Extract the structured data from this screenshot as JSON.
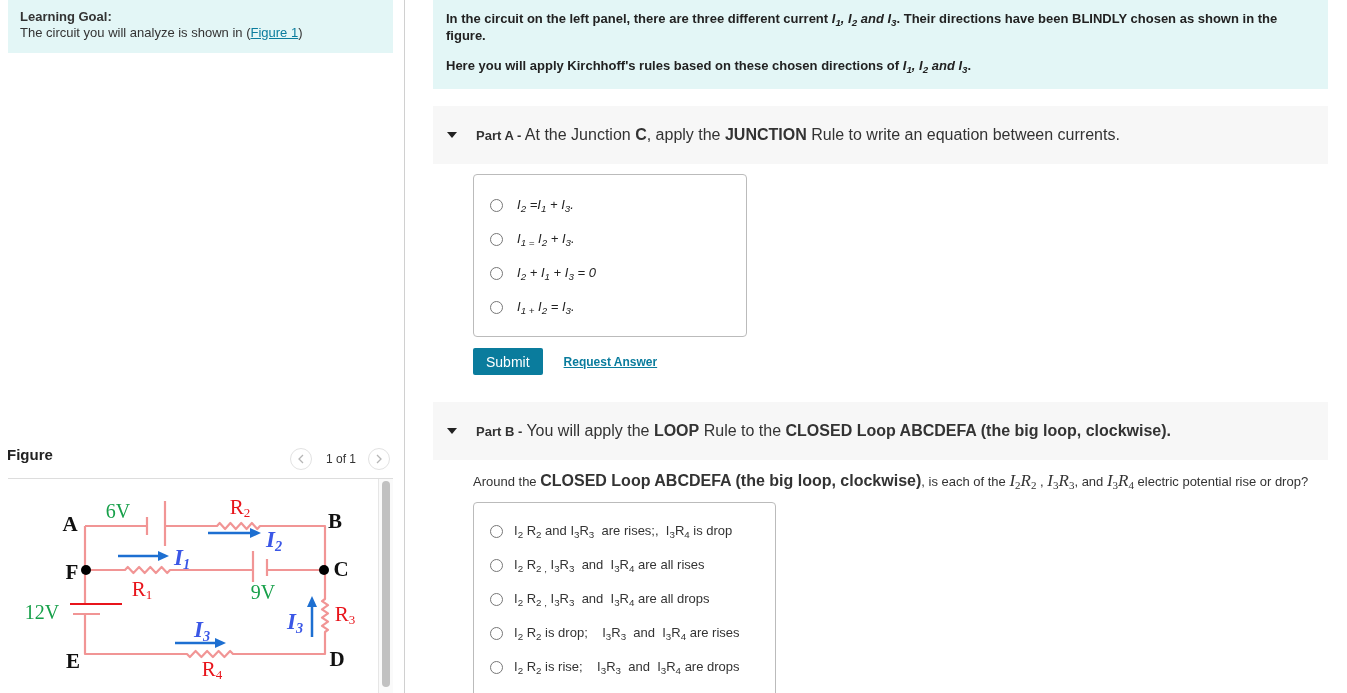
{
  "learning_goal": {
    "heading": "Learning Goal:",
    "text_before": "The circuit you will analyze is shown in (",
    "link": "Figure 1",
    "text_after": ")"
  },
  "figure": {
    "heading": "Figure",
    "pager": "1 of 1",
    "labels": [
      {
        "kind": "source",
        "text": "6V"
      },
      {
        "kind": "resistor",
        "text": "R$_{2}$"
      },
      {
        "kind": "node",
        "text": "A"
      },
      {
        "kind": "node",
        "text": "B"
      },
      {
        "kind": "current",
        "text": "I$_{2}$"
      },
      {
        "kind": "current",
        "text": "I$_{1}$"
      },
      {
        "kind": "node",
        "text": "F"
      },
      {
        "kind": "node",
        "text": "C"
      },
      {
        "kind": "resistor",
        "text": "R$_{1}$"
      },
      {
        "kind": "source",
        "text": "9V"
      },
      {
        "kind": "source",
        "text": "12V"
      },
      {
        "kind": "resistor",
        "text": "R$_{3}$"
      },
      {
        "kind": "current",
        "text": "I$_{3}$"
      },
      {
        "kind": "current",
        "text": "I$_{3}$"
      },
      {
        "kind": "node",
        "text": "E"
      },
      {
        "kind": "node",
        "text": "D"
      },
      {
        "kind": "resistor",
        "text": "R$_{4}$"
      }
    ]
  },
  "intro": {
    "paragraphs": [
      "In the circuit on the left panel, there are three different current *I$_{1}$, I$_{2}$ and I$_{3}$*. Their directions have been BLINDLY chosen as shown in the figure.",
      "Here you will apply Kirchhoff's rules based on these chosen directions of *I$_{1}$, I$_{2}$ and I$_{3}$*."
    ]
  },
  "parts": [
    {
      "kind": "equations",
      "label": "Part A -",
      "title": "At the Junction **C**, apply the **JUNCTION** Rule to write an equation between currents.",
      "expanded": true,
      "options": [
        {
          "text": "I$_{2}$ =I$_{1}$ + I$_{3}$.",
          "selected": false
        },
        {
          "text": "I$_{1 =}$ I$_{2}$ + I$_{3}$.",
          "selected": false
        },
        {
          "text": "I$_{2}$ + I$_{1}$ + I$_{3}$ = 0",
          "selected": false
        },
        {
          "text": "I$_{1 +}$ I$_{2}$ = I$_{3}$.",
          "selected": false
        }
      ],
      "buttons": {
        "submit": "Submit",
        "request_answer": "Request Answer"
      }
    },
    {
      "kind": "statements",
      "label": "Part B -",
      "title": "You will apply the **LOOP** Rule to the **CLOSED Loop ABCDEFA (the big loop, clockwise).**",
      "expanded": true,
      "question": "Around the **CLOSED Loop ABCDEFA (the big loop, clockwise)**, is each of the *I*$_{2}$*R*$_{2}$ , *I*$_{3}$*R*$_{3}$, and *I*$_{3}$*R*$_{4}$ electric potential rise or drop?",
      "options": [
        {
          "text": "I$_{2}$ R$_{2}$ and I$_{3}$R$_{3}$  are rises;,  I$_{3}$R$_{4}$ is drop",
          "selected": false
        },
        {
          "text": "I$_{2}$ R$_{2 ,}$ I$_{3}$R$_{3}$  and  I$_{3}$R$_{4}$ are all rises",
          "selected": false
        },
        {
          "text": "I$_{2}$ R$_{2 ,}$ I$_{3}$R$_{3}$  and  I$_{3}$R$_{4}$ are all drops",
          "selected": false
        },
        {
          "text": "I$_{2}$ R$_{2}$ is drop;    I$_{3}$R$_{3}$  and  I$_{3}$R$_{4}$ are rises",
          "selected": false
        },
        {
          "text": "I$_{2}$ R$_{2}$ is rise;    I$_{3}$R$_{3}$  and  I$_{3}$R$_{4}$ are drops",
          "selected": false
        }
      ]
    }
  ]
}
